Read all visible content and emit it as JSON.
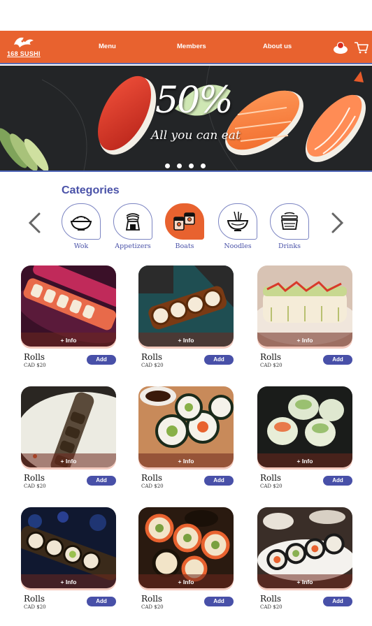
{
  "header": {
    "brand": "168 SUSHI",
    "nav": [
      "Menu",
      "Members",
      "About us"
    ]
  },
  "hero": {
    "promo_big": "50%",
    "promo_sub": "All you can eat",
    "slides": 4
  },
  "categories": {
    "title": "Categories",
    "items": [
      {
        "label": "Wok",
        "icon": "bowl-icon"
      },
      {
        "label": "Appetizers",
        "icon": "onigiri-icon"
      },
      {
        "label": "Boats",
        "icon": "sushi-boat-icon",
        "active": true
      },
      {
        "label": "Noodles",
        "icon": "noodle-bowl-icon"
      },
      {
        "label": "Drinks",
        "icon": "drink-cup-icon"
      }
    ]
  },
  "products": {
    "info_label": "+ Info",
    "add_label": "Add",
    "items": [
      {
        "name": "Rolls",
        "price": "CAD $20"
      },
      {
        "name": "Rolls",
        "price": "CAD $20"
      },
      {
        "name": "Rolls",
        "price": "CAD $20"
      },
      {
        "name": "Rolls",
        "price": "CAD $20"
      },
      {
        "name": "Rolls",
        "price": "CAD $20"
      },
      {
        "name": "Rolls",
        "price": "CAD $20"
      },
      {
        "name": "Rolls",
        "price": "CAD $20"
      },
      {
        "name": "Rolls",
        "price": "CAD $20"
      },
      {
        "name": "Rolls",
        "price": "CAD $20"
      }
    ]
  },
  "colors": {
    "brand_orange": "#e8622f",
    "accent_blue": "#4850a8"
  }
}
